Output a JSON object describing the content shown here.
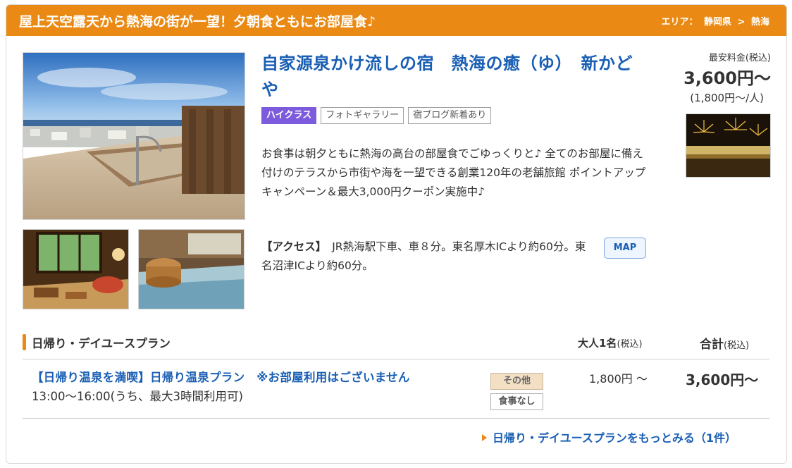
{
  "banner": {
    "title": "屋上天空露天から熱海の街が一望！夕朝食ともにお部屋食♪",
    "area_label": "エリア：",
    "prefecture": "静岡県",
    "separator": ">",
    "city": "熱海"
  },
  "hotel": {
    "name": "自家源泉かけ流しの宿　熱海の癒（ゆ）　新かどや",
    "tags": [
      "ハイクラス",
      "フォトギャラリー",
      "宿ブログ新着あり"
    ],
    "description": "お食事は朝夕ともに熱海の高台の部屋食でごゆっくりと♪ 全てのお部屋に備え付けのテラスから市街や海を一望できる創業120年の老舗旅館 ポイントアップキャンペーン＆最大3,000円クーポン実施中♪",
    "access_label": "【アクセス】",
    "access_text": "JR熱海駅下車、車８分。東名厚木ICより約60分。東名沼津ICより約60分。",
    "map_button": "MAP"
  },
  "price": {
    "label": "最安料金(税込)",
    "amount": "3,600円〜",
    "per_person": "(1,800円〜/人)"
  },
  "plan_section": {
    "title": "日帰り・デイユースプラン",
    "col_adult": "大人1名",
    "col_adult_note": "(税込)",
    "col_total": "合計",
    "col_total_note": "(税込)",
    "plans": [
      {
        "name": "【日帰り温泉を満喫】日帰り温泉プラン　※お部屋利用はございません",
        "time": "13:00〜16:00(うち、最大3時間利用可)",
        "badge_type": "その他",
        "badge_meal": "食事なし",
        "adult_price": "1,800円 〜",
        "total_price": "3,600円〜"
      }
    ],
    "more_link": "日帰り・デイユースプランをもっとみる（1件）"
  },
  "colors": {
    "banner": "#ea8a14",
    "link": "#1a5fb4",
    "highclass_tag": "#7c5cdc"
  }
}
